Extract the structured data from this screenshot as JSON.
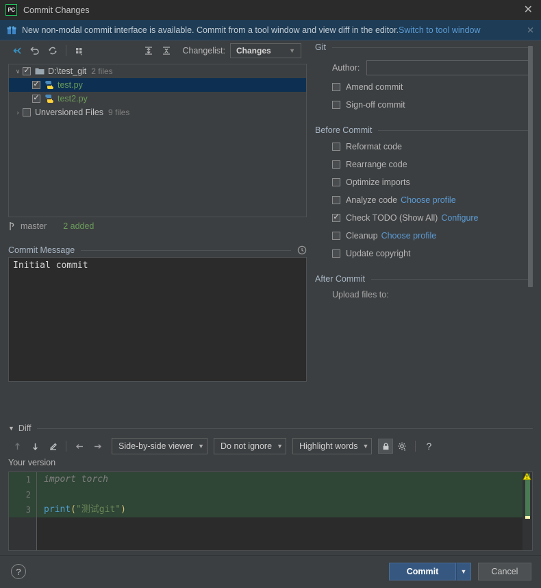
{
  "window": {
    "title": "Commit Changes",
    "logo_text": "PC",
    "close_label": "✕"
  },
  "notification": {
    "icon": "gift-icon",
    "text": "New non-modal commit interface is available. Commit from a tool window and view diff in the editor.",
    "link": "Switch to tool window",
    "close_label": "✕",
    "link_color": "#5b9bd5",
    "background": "#1e3c55"
  },
  "changes_toolbar": {
    "icons": [
      "show-diff-icon",
      "rollback-icon",
      "refresh-icon",
      "group-by-icon",
      "expand-all-icon",
      "collapse-all-icon"
    ],
    "changelist_label": "Changelist:",
    "changelist_value": "Changes",
    "changelist_arrow": "▼"
  },
  "file_tree": {
    "rows": [
      {
        "name": "D:\\test_git",
        "count": "2 files",
        "checked": true,
        "expanded": true,
        "twisty": "∨",
        "icon": "folder-icon",
        "selected": false,
        "added": false,
        "indent": 0
      },
      {
        "name": "test.py",
        "count": "",
        "checked": true,
        "icon": "python-file-icon",
        "selected": true,
        "added": true,
        "indent": 1
      },
      {
        "name": "test2.py",
        "count": "",
        "checked": true,
        "icon": "python-file-icon",
        "selected": false,
        "added": true,
        "indent": 1
      },
      {
        "name": "Unversioned Files",
        "count": "9 files",
        "checked": false,
        "expanded": false,
        "twisty": "›",
        "icon": "",
        "selected": false,
        "added": false,
        "indent": 0
      }
    ]
  },
  "branch_bar": {
    "icon": "branch-icon",
    "branch": "master",
    "status": "2 added"
  },
  "commit_message": {
    "label": "Commit Message",
    "history_icon": "clock-icon",
    "value": "Initial commit"
  },
  "git_section": {
    "title": "Git",
    "author_label": "Author:",
    "author_value": "",
    "options": [
      {
        "label": "Amend commit",
        "checked": false
      },
      {
        "label": "Sign-off commit",
        "checked": false
      }
    ]
  },
  "before_commit": {
    "title": "Before Commit",
    "options": [
      {
        "label": "Reformat code",
        "checked": false,
        "link": ""
      },
      {
        "label": "Rearrange code",
        "checked": false,
        "link": ""
      },
      {
        "label": "Optimize imports",
        "checked": false,
        "link": ""
      },
      {
        "label": "Analyze code",
        "checked": false,
        "link": "Choose profile"
      },
      {
        "label": "Check TODO (Show All)",
        "checked": true,
        "link": "Configure"
      },
      {
        "label": "Cleanup",
        "checked": false,
        "link": "Choose profile"
      },
      {
        "label": "Update copyright",
        "checked": false,
        "link": ""
      }
    ]
  },
  "after_commit": {
    "title": "After Commit",
    "cut_off_label": "Upload files to:"
  },
  "diff": {
    "title": "Diff",
    "collapse_arrow": "▼",
    "toolbar_icons": [
      "previous-difference-icon",
      "next-difference-icon",
      "edit-source-icon",
      "accept-left-icon",
      "accept-right-icon"
    ],
    "viewer_mode": "Side-by-side viewer",
    "ignore_mode": "Do not ignore",
    "highlight_mode": "Highlight words",
    "lock_icon": "lock-icon",
    "settings_icon": "gear-icon",
    "help_icon": "question-mark-icon",
    "dropdown_arrow": "▼",
    "pane_label": "Your version",
    "warning_icon": "warning-triangle-icon",
    "lines": [
      {
        "num": "1",
        "inserted": true,
        "tokens": [
          {
            "t": "import torch",
            "c": "tok-unused"
          }
        ]
      },
      {
        "num": "2",
        "inserted": true,
        "tokens": [
          {
            "t": "",
            "c": ""
          }
        ]
      },
      {
        "num": "3",
        "inserted": true,
        "tokens": [
          {
            "t": "print",
            "c": "tok-fn"
          },
          {
            "t": "(",
            "c": "tok-punc"
          },
          {
            "t": "\"测试git\"",
            "c": "tok-str"
          },
          {
            "t": ")",
            "c": "tok-punc"
          }
        ]
      }
    ]
  },
  "bottom_bar": {
    "help_label": "?",
    "commit_label": "Commit",
    "commit_arrow": "▼",
    "cancel_label": "Cancel",
    "commit_color": "#365880"
  }
}
